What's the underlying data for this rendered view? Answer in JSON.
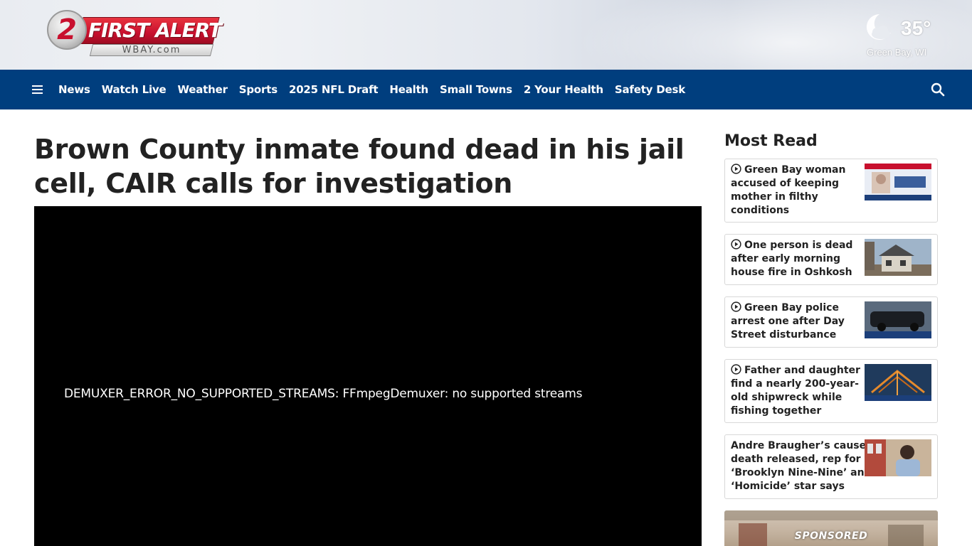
{
  "header": {
    "logo": {
      "number": "2",
      "brand": "FIRST ALERT",
      "site": "WBAY.com"
    },
    "weather": {
      "icon": "moon-cloud-icon",
      "temperature": "35°",
      "location": "Green Bay, WI"
    }
  },
  "nav": {
    "menu_icon": "hamburger-menu-icon",
    "items": [
      "News",
      "Watch Live",
      "Weather",
      "Sports",
      "2025 NFL Draft",
      "Health",
      "Small Towns",
      "2 Your Health",
      "Safety Desk"
    ],
    "search_icon": "search-icon"
  },
  "article": {
    "headline": "Brown County inmate found dead in his jail cell, CAIR calls for investigation",
    "video_error": "DEMUXER_ERROR_NO_SUPPORTED_STREAMS: FFmpegDemuxer: no supported streams"
  },
  "sidebar": {
    "title": "Most Read",
    "items": [
      {
        "title": "Green Bay woman accused of keeping mother in filthy conditions",
        "has_video": true,
        "thumb": "mugshot-graphic"
      },
      {
        "title": "One person is dead after early morning house fire in Oshkosh",
        "has_video": true,
        "thumb": "house-photo"
      },
      {
        "title": "Green Bay police arrest one after Day Street disturbance",
        "has_video": true,
        "thumb": "police-car-photo"
      },
      {
        "title": "Father and daughter find a nearly 200-year-old shipwreck while fishing together",
        "has_video": true,
        "thumb": "shipwreck-graphic"
      },
      {
        "title": "Andre Braugher’s cause of death released, rep for ‘Brooklyn Nine-Nine’ and ‘Homicide’ star says",
        "has_video": false,
        "thumb": "portrait-photo"
      }
    ],
    "sponsored_label": "SPONSORED"
  },
  "colors": {
    "nav_bg": "#003e7e",
    "brand_red": "#c8102e"
  }
}
